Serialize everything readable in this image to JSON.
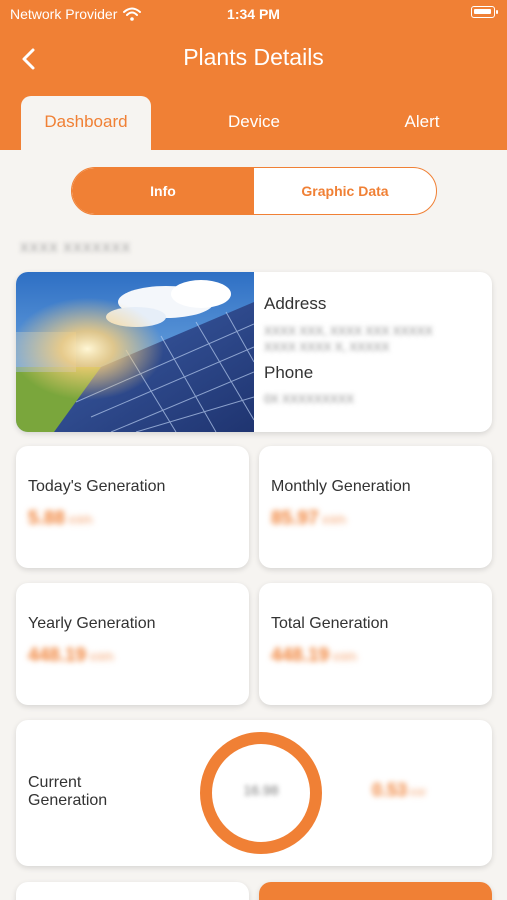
{
  "status_bar": {
    "carrier": "Network Provider",
    "time": "1:34 PM"
  },
  "header": {
    "title": "Plants Details"
  },
  "tabs": [
    {
      "label": "Dashboard",
      "active": true
    },
    {
      "label": "Device",
      "active": false
    },
    {
      "label": "Alert",
      "active": false
    }
  ],
  "segment": {
    "info": "Info",
    "graphic": "Graphic Data"
  },
  "plant": {
    "name": "XXXX XXXXXXX",
    "address_label": "Address",
    "address_line1": "XXXX XXX, XXXX XXX XXXXX",
    "address_line2": "XXXX XXXX X, XXXXX",
    "phone_label": "Phone",
    "phone_value": "0X XXXXXXXXX"
  },
  "stats": {
    "today": {
      "title": "Today's Generation",
      "value": "5.88",
      "unit": "kWh"
    },
    "monthly": {
      "title": "Monthly Generation",
      "value": "85.97",
      "unit": "kWh"
    },
    "yearly": {
      "title": "Yearly Generation",
      "value": "448.19",
      "unit": "kWh"
    },
    "total": {
      "title": "Total Generation",
      "value": "448.19",
      "unit": "kWh"
    }
  },
  "current": {
    "title": "Current Generation",
    "ring_value": "16.98",
    "value": "0.53",
    "unit": "kW"
  },
  "colors": {
    "accent": "#f08035",
    "background": "#f6f4f1",
    "card": "#ffffff"
  },
  "icons": {
    "back": "chevron-left-icon",
    "wifi": "wifi-icon",
    "battery": "battery-icon"
  }
}
